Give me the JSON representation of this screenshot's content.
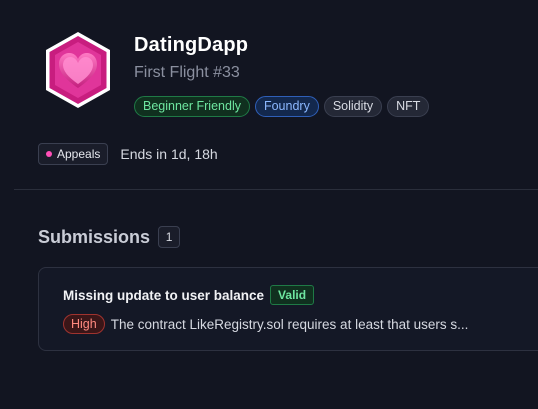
{
  "contest": {
    "title": "DatingDapp",
    "subtitle": "First Flight #33",
    "tags": [
      {
        "label": "Beginner Friendly",
        "variant": "green"
      },
      {
        "label": "Foundry",
        "variant": "blue"
      },
      {
        "label": "Solidity",
        "variant": "gray"
      },
      {
        "label": "NFT",
        "variant": "gray"
      }
    ],
    "logo_icon": "heart-hexagon-icon",
    "accent_color": "#e6399b"
  },
  "status": {
    "phase_label": "Appeals",
    "phase_color": "#ff4fb7",
    "ends_text": "Ends in 1d, 18h"
  },
  "submissions": {
    "heading": "Submissions",
    "count": "1",
    "items": [
      {
        "title": "Missing update to user balance",
        "validity": "Valid",
        "severity": "High",
        "description": "The contract LikeRegistry.sol requires at least that users s..."
      }
    ]
  }
}
